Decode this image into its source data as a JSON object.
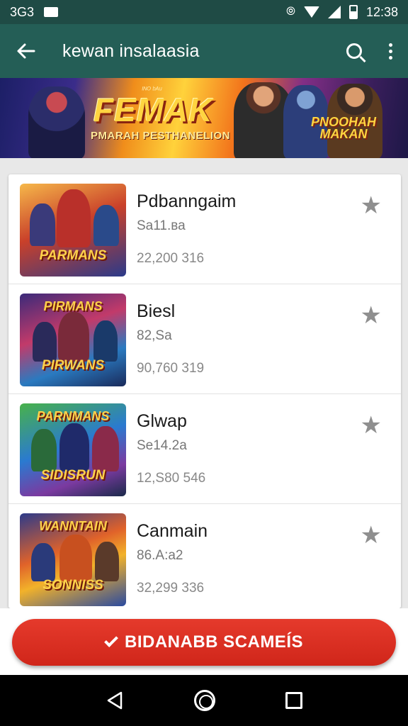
{
  "status_bar": {
    "left_text": "3G3",
    "time": "12:38"
  },
  "app_bar": {
    "title": "kewan insalaasia"
  },
  "banner": {
    "kicker": "ᴵᴺᴼ ᵇᴬᵘ",
    "title": "FEMAK",
    "subtitle": "PMARAH PESTHANELION",
    "right_title": "PNOOHAH MAKAN"
  },
  "games": [
    {
      "title": "Pdbanngaim",
      "subtitle": "Sa11.ва",
      "count": "22,200 316",
      "thumb_title": "PARMANS",
      "thumb_top": ""
    },
    {
      "title": "Biesl",
      "subtitle": "82,Sa",
      "count": "90,760 319",
      "thumb_title": "PIRWANS",
      "thumb_top": "PIRMANS"
    },
    {
      "title": "Glwap",
      "subtitle": "Se14.2a",
      "count": "12,S80 546",
      "thumb_title": "SIDISRUN",
      "thumb_top": "PARNMANS"
    },
    {
      "title": "Canmain",
      "subtitle": "86.A:a2",
      "count": "32,299 336",
      "thumb_title": "SONNISS",
      "thumb_top": "WANNTAIN"
    }
  ],
  "cta": {
    "label": "BIDANABB SCAMEÍS"
  },
  "icons": {
    "back": "back-arrow-icon",
    "search": "search-icon",
    "more": "more-vert-icon",
    "star": "star-icon",
    "check": "check-icon"
  },
  "colors": {
    "app_bar": "#245e56",
    "status_bar": "#1f4b45",
    "cta": "#d92f22",
    "star": "#8f8f8f"
  }
}
